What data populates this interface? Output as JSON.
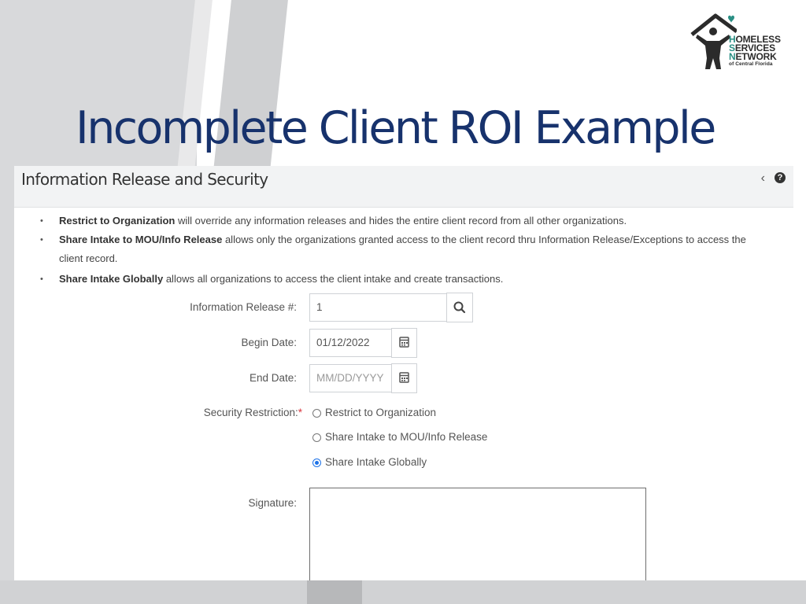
{
  "logo": {
    "line1_initial": "H",
    "line1_rest": "OMELESS",
    "line2_initial": "S",
    "line2_rest": "ERVICES",
    "line3_initial": "N",
    "line3_rest": "ETWORK",
    "subtitle": "of Central Florida"
  },
  "slide": {
    "title": "Incomplete Client ROI Example"
  },
  "panel": {
    "title": "Information Release and Security",
    "collapse_icon": "chevron-left-icon",
    "help_icon": "question-circle-icon"
  },
  "notes": [
    {
      "bold": "Restrict to Organization",
      "text": " will override any information releases and hides the entire client record from all other organizations."
    },
    {
      "bold": "Share Intake to MOU/Info Release",
      "text": " allows only the organizations granted access to the client record thru Information Release/Exceptions to access the client record."
    },
    {
      "bold": "Share Intake Globally",
      "text": " allows all organizations to access the client intake and create transactions."
    }
  ],
  "form": {
    "info_release": {
      "label": "Information Release #:",
      "value": "1",
      "icon": "search-icon"
    },
    "begin_date": {
      "label": "Begin Date:",
      "value": "01/12/2022",
      "icon": "calendar-icon"
    },
    "end_date": {
      "label": "End Date:",
      "placeholder": "MM/DD/YYYY",
      "icon": "calendar-icon"
    },
    "security": {
      "label": "Security Restriction:",
      "required_mark": "*",
      "options": [
        "Restrict to Organization",
        "Share Intake to MOU/Info Release",
        "Share Intake Globally"
      ],
      "selected": "Share Intake Globally"
    },
    "signature": {
      "label": "Signature:"
    }
  },
  "colors": {
    "title": "#17326c",
    "accent_teal": "#2a8f84",
    "radio_selected": "#1e73e8",
    "required": "#d9363e"
  }
}
